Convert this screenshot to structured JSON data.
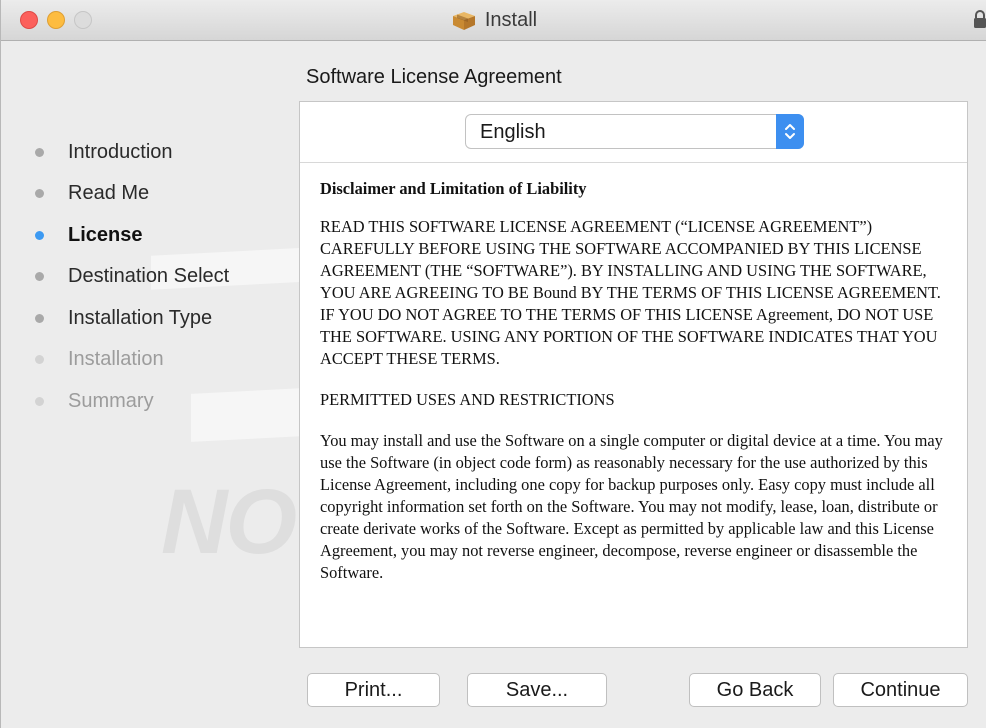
{
  "window": {
    "title": "Install"
  },
  "steps": [
    {
      "label": "Introduction",
      "state": "done"
    },
    {
      "label": "Read Me",
      "state": "done"
    },
    {
      "label": "License",
      "state": "current"
    },
    {
      "label": "Destination Select",
      "state": "pending"
    },
    {
      "label": "Installation Type",
      "state": "pending"
    },
    {
      "label": "Installation",
      "state": "disabled"
    },
    {
      "label": "Summary",
      "state": "disabled"
    }
  ],
  "section_title": "Software License Agreement",
  "language_select": {
    "value": "English"
  },
  "license": {
    "heading": "Disclaimer and Limitation of Liability",
    "paragraphs": [
      "READ THIS SOFTWARE LICENSE AGREEMENT (“LICENSE AGREEMENT”) CAREFULLY BEFORE USING THE SOFTWARE ACCOMPANIED BY THIS LICENSE AGREEMENT (THE “SOFTWARE”). BY INSTALLING AND USING THE SOFTWARE, YOU ARE AGREEING TO BE Bound BY THE TERMS OF THIS LICENSE AGREEMENT. IF YOU DO NOT AGREE TO THE TERMS OF THIS LICENSE Agreement, DO NOT USE THE SOFTWARE. USING ANY PORTION OF THE SOFTWARE INDICATES THAT YOU ACCEPT THESE TERMS.",
      "PERMITTED USES AND RESTRICTIONS",
      "You may install and use the Software on a single computer or digital device at a time. You may use the Software (in object code form) as reasonably necessary for the use authorized by this License Agreement, including one copy for backup purposes only. Easy copy must include all copyright information set forth on the Software. You may not modify, lease, loan, distribute or create derivate works of the Software. Except as permitted by applicable law and this License Agreement, you may not reverse engineer, decompose, reverse engineer or disassemble the Software."
    ]
  },
  "buttons": {
    "print": "Print...",
    "save": "Save...",
    "go_back": "Go Back",
    "continue": "Continue"
  },
  "watermark": "NOV",
  "colors": {
    "accent": "#3d8ff0",
    "close": "#fc605c",
    "minimize": "#fdbc40"
  },
  "icons": {
    "title": "package-icon",
    "lock": "lock-icon",
    "select": "up-down-chevron-icon"
  }
}
